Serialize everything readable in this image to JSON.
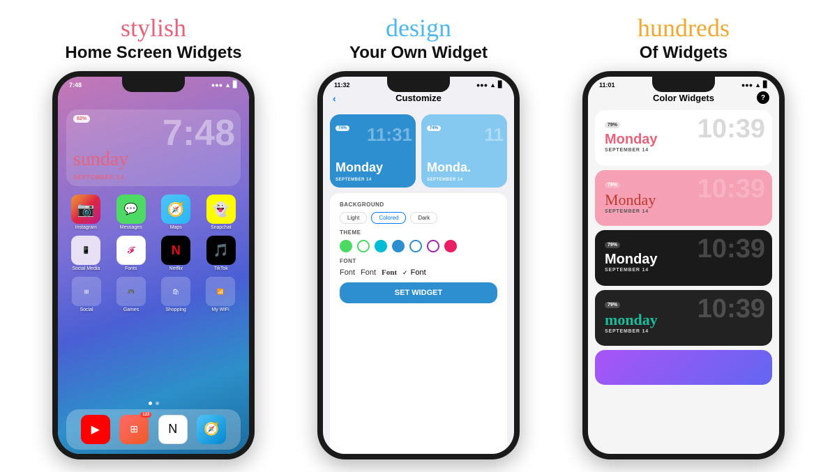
{
  "panels": [
    {
      "id": "panel1",
      "cursive_text": "stylish",
      "cursive_color": "pink",
      "bold_line": "Home Screen Widgets",
      "phone": {
        "status_time": "7:48",
        "theme": "home",
        "widget": {
          "battery": "82%",
          "time": "7:48",
          "day": "sunday",
          "date": "SEPTEMBER 13"
        },
        "apps_row1": [
          {
            "label": "Instagram",
            "color": "instagram"
          },
          {
            "label": "Messages",
            "color": "messages"
          },
          {
            "label": "Maps",
            "color": "maps"
          },
          {
            "label": "Snapchat",
            "color": "snapchat"
          }
        ],
        "apps_row2": [
          {
            "label": "Social Media",
            "color": "social"
          },
          {
            "label": "Fonts",
            "color": "fonts"
          },
          {
            "label": "Netflix",
            "color": "netflix"
          },
          {
            "label": "TikTok",
            "color": "tiktok"
          }
        ],
        "dock_apps": [
          "YouTube",
          "Shortcut",
          "Notion",
          "Safari"
        ]
      }
    },
    {
      "id": "panel2",
      "cursive_text": "design",
      "cursive_color": "blue",
      "bold_line": "Your Own Widget",
      "phone": {
        "status_time": "11:32",
        "theme": "customize",
        "header": "Customize",
        "widgets": [
          {
            "type": "blue",
            "battery": "74%",
            "time": "11:31",
            "day": "Monday",
            "date": "SEPTEMBER 14"
          },
          {
            "type": "light-blue",
            "battery": "74%",
            "time": "11",
            "day": "Monda.",
            "date": "SEPTEMBER 14"
          }
        ],
        "background": {
          "label": "BACKGROUND",
          "options": [
            "Light",
            "Colored",
            "Dark"
          ],
          "selected": "Colored"
        },
        "theme_section": {
          "label": "THEME",
          "dots": [
            "green",
            "green-outline",
            "teal",
            "blue",
            "blue-outline",
            "purple-outline",
            "pink"
          ]
        },
        "font_section": {
          "label": "FONT",
          "options": [
            "Font",
            "Font",
            "Font",
            "Font"
          ],
          "selected_index": 3
        },
        "set_widget_btn": "SET WIDGET"
      }
    },
    {
      "id": "panel3",
      "cursive_text": "hundreds",
      "cursive_color": "orange",
      "bold_line": "Of Widgets",
      "phone": {
        "status_time": "11:01",
        "theme": "colorwidgets",
        "header": "Color Widgets",
        "widgets": [
          {
            "bg": "white",
            "battery": "79%",
            "time": "10:39",
            "day": "Monday",
            "date": "SEPTEMBER 14",
            "style": "red"
          },
          {
            "bg": "pink",
            "battery": "79%",
            "time": "10:39",
            "day": "Monday",
            "date": "SEPTEMBER 14",
            "style": "cursive-dark"
          },
          {
            "bg": "black",
            "battery": "79%",
            "time": "10:39",
            "day": "Monday",
            "date": "SEPTEMBER 14",
            "style": "white-bold"
          },
          {
            "bg": "dark",
            "battery": "79%",
            "time": "10:39",
            "day": "monday",
            "date": "SEPTEMBER 14",
            "style": "teal-cursive"
          },
          {
            "bg": "gradient",
            "battery": "",
            "time": "",
            "day": "",
            "date": "",
            "style": "partial"
          }
        ]
      }
    }
  ]
}
